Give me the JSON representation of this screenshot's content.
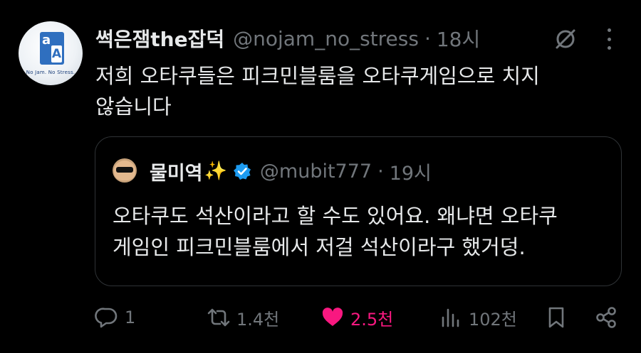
{
  "post": {
    "author_name": "썩은잼the잡덕",
    "handle": "@nojam_no_stress",
    "separator": "·",
    "time": "18시",
    "text_lines": [
      "저희 오타쿠들은 피크민블룸을 오타쿠게임으로 치지",
      "않습니다"
    ],
    "avatar": {
      "tagline": "No Jam. No Stress."
    }
  },
  "quoted": {
    "author_name": "물미역",
    "emoji": "✨",
    "handle": "@mubit777",
    "separator": "·",
    "time": "19시",
    "verified": true,
    "text_lines": [
      "오타쿠도 석산이라고 할 수도 있어요. 왜냐면 오타쿠",
      "게임인 피크민블룸에서 저걸 석산이라구 했거덩."
    ]
  },
  "actions": {
    "replies": "1",
    "reposts": "1.4천",
    "likes": "2.5천",
    "views": "102천"
  },
  "icons": {
    "grok": "grok-icon",
    "more": "more-icon",
    "reply": "reply-icon",
    "repost": "repost-icon",
    "like": "heart-icon",
    "views": "views-icon",
    "bookmark": "bookmark-icon",
    "share": "share-icon"
  },
  "colors": {
    "background": "#000000",
    "text": "#e7e9ea",
    "muted": "#71767b",
    "like": "#f91880",
    "verified": "#1d9bf0",
    "border": "#2f3336"
  }
}
